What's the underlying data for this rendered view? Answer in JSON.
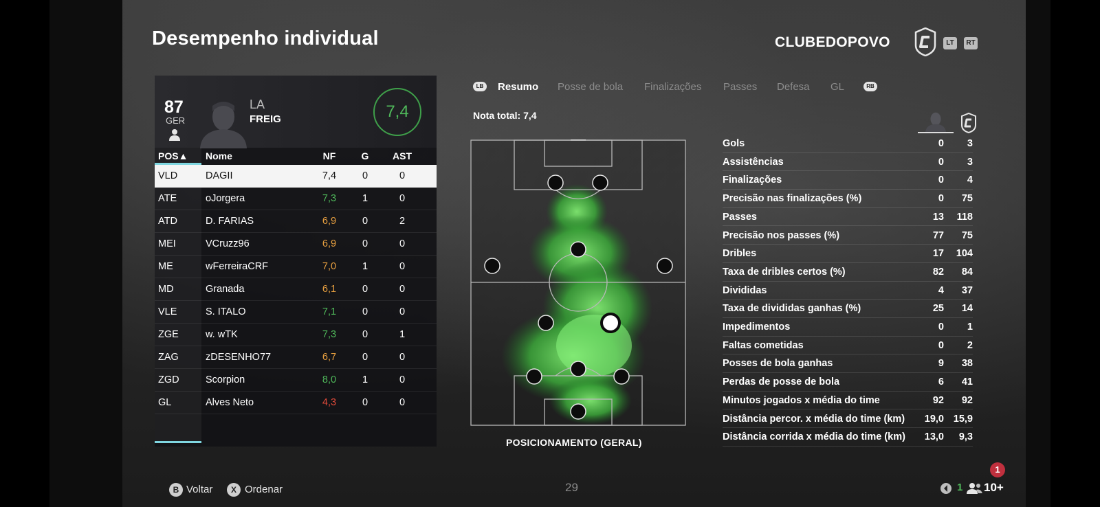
{
  "header": {
    "title": "Desempenho individual",
    "club": "CLUBEDOPOVO",
    "trigger_left": "LT",
    "trigger_right": "RT"
  },
  "player": {
    "overall": "87",
    "position": "GER",
    "name_line1": "LA",
    "name_line2": "FREIG",
    "match_rating": "7,4"
  },
  "table": {
    "headers": {
      "pos": "POS▲",
      "name": "Nome",
      "nf": "NF",
      "g": "G",
      "ast": "AST"
    },
    "rows": [
      {
        "pos": "VLD",
        "name": "DAGII",
        "nf": "7,4",
        "g": "0",
        "ast": "0"
      },
      {
        "pos": "ATE",
        "name": "oJorgera",
        "nf": "7,3",
        "g": "1",
        "ast": "0"
      },
      {
        "pos": "ATD",
        "name": "D. FARIAS",
        "nf": "6,9",
        "g": "0",
        "ast": "2"
      },
      {
        "pos": "MEI",
        "name": "VCruzz96",
        "nf": "6,9",
        "g": "0",
        "ast": "0"
      },
      {
        "pos": "ME",
        "name": "wFerreiraCRF",
        "nf": "7,0",
        "g": "1",
        "ast": "0"
      },
      {
        "pos": "MD",
        "name": "Granada",
        "nf": "6,1",
        "g": "0",
        "ast": "0"
      },
      {
        "pos": "VLE",
        "name": "S. ITALO",
        "nf": "7,1",
        "g": "0",
        "ast": "0"
      },
      {
        "pos": "ZGE",
        "name": "w. wTK",
        "nf": "7,3",
        "g": "0",
        "ast": "1"
      },
      {
        "pos": "ZAG",
        "name": "zDESENHO77",
        "nf": "6,7",
        "g": "0",
        "ast": "0"
      },
      {
        "pos": "ZGD",
        "name": "Scorpion",
        "nf": "8,0",
        "g": "1",
        "ast": "0"
      },
      {
        "pos": "GL",
        "name": "Alves Neto",
        "nf": "4,3",
        "g": "0",
        "ast": "0"
      }
    ]
  },
  "tabs": {
    "lb": "LB",
    "rb": "RB",
    "items": [
      "Resumo",
      "Posse de bola",
      "Finalizações",
      "Passes",
      "Defesa",
      "GL"
    ],
    "active": "Resumo"
  },
  "nota_total": "Nota total: 7,4",
  "pitch_label": "POSICIONAMENTO (GERAL)",
  "stats": [
    {
      "label": "Gols",
      "player": "0",
      "team": "3"
    },
    {
      "label": "Assistências",
      "player": "0",
      "team": "3"
    },
    {
      "label": "Finalizações",
      "player": "0",
      "team": "4"
    },
    {
      "label": "Precisão nas finalizações (%)",
      "player": "0",
      "team": "75"
    },
    {
      "label": "Passes",
      "player": "13",
      "team": "118"
    },
    {
      "label": "Precisão nos passes (%)",
      "player": "77",
      "team": "75"
    },
    {
      "label": "Dribles",
      "player": "17",
      "team": "104"
    },
    {
      "label": "Taxa de dribles certos (%)",
      "player": "82",
      "team": "84"
    },
    {
      "label": "Divididas",
      "player": "4",
      "team": "37"
    },
    {
      "label": "Taxa de divididas ganhas (%)",
      "player": "25",
      "team": "14"
    },
    {
      "label": "Impedimentos",
      "player": "0",
      "team": "1"
    },
    {
      "label": "Faltas cometidas",
      "player": "0",
      "team": "2"
    },
    {
      "label": "Posses de bola ganhas",
      "player": "9",
      "team": "38"
    },
    {
      "label": "Perdas de posse de bola",
      "player": "6",
      "team": "41"
    },
    {
      "label": "Minutos jogados x média do time",
      "player": "92",
      "team": "92"
    },
    {
      "label": "Distância percor. x média do time (km)",
      "player": "19,0",
      "team": "15,9"
    },
    {
      "label": "Distância corrida x média do time (km)",
      "player": "13,0",
      "team": "9,3"
    }
  ],
  "footer": {
    "back_key": "B",
    "back_label": "Voltar",
    "sort_key": "X",
    "sort_label": "Ordenar",
    "page": "29",
    "notification_count": "1",
    "count_a": "1",
    "count_b": "10+"
  },
  "colors": {
    "accent_green": "#4fb85a",
    "rating_orange": "#e8a040",
    "rating_red": "#e04a3a",
    "tab_underline": "#7fd6e0"
  },
  "icons": [
    "person-icon",
    "club-crest-icon",
    "sound-icon",
    "group-icon"
  ]
}
